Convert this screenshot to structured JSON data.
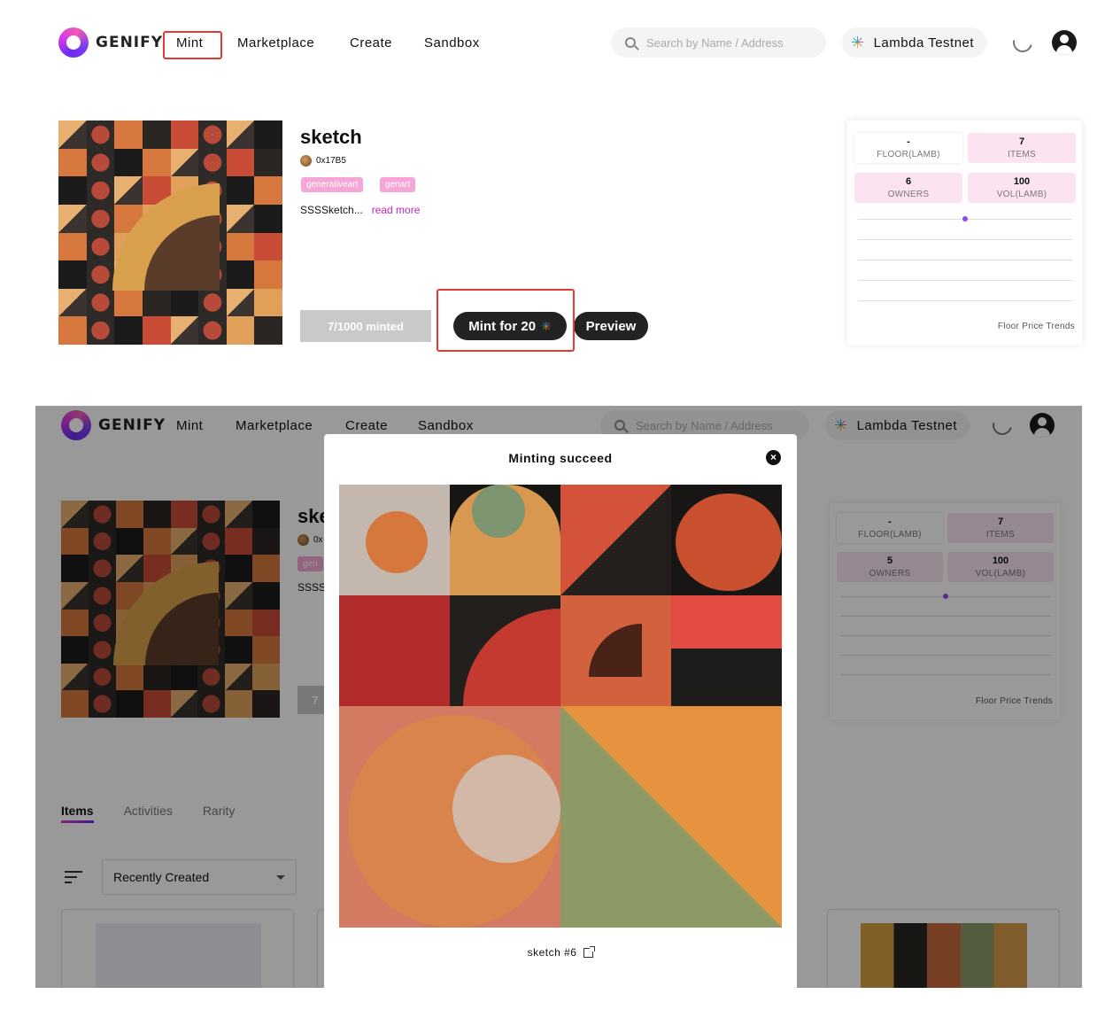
{
  "brand": {
    "name": "GENIFY"
  },
  "nav": {
    "mint": "Mint",
    "marketplace": "Marketplace",
    "create": "Create",
    "sandbox": "Sandbox"
  },
  "search": {
    "placeholder": "Search by Name / Address"
  },
  "network": {
    "label": "Lambda Testnet"
  },
  "collection": {
    "title": "sketch",
    "owner": "0x17B5",
    "tags": [
      "generativeart",
      "genart"
    ],
    "description": "SSSSketch...",
    "read_more": "read more",
    "minted": "7/1000 minted",
    "mint_button": "Mint for 20",
    "preview_button": "Preview"
  },
  "stats_top": {
    "floor": {
      "value": "-",
      "label": "FLOOR(LAMB)"
    },
    "items": {
      "value": "7",
      "label": "ITEMS"
    },
    "owners": {
      "value": "6",
      "label": "OWNERS"
    },
    "vol": {
      "value": "100",
      "label": "VOL(LAMB)"
    },
    "trend": "Floor Price Trends"
  },
  "stats_bottom": {
    "floor": {
      "value": "-",
      "label": "FLOOR(LAMB)"
    },
    "items": {
      "value": "7",
      "label": "ITEMS"
    },
    "owners": {
      "value": "5",
      "label": "OWNERS"
    },
    "vol": {
      "value": "100",
      "label": "VOL(LAMB)"
    },
    "trend": "Floor Price Trends"
  },
  "bg_title_fragment": "ske",
  "bg_owner_fragment": "0x",
  "bg_tag_fragment": "gen",
  "bg_desc_fragment": "SSSS",
  "bg_minted_fragment": "7",
  "tabs": {
    "items": "Items",
    "activities": "Activities",
    "rarity": "Rarity"
  },
  "sort": {
    "selected": "Recently Created"
  },
  "modal": {
    "title": "Minting succeed",
    "close": "×",
    "caption": "sketch #6"
  },
  "colors": {
    "accent": "#c225c2",
    "highlight": "#e53935",
    "tag": "#f6a6d6",
    "stat_pink": "#fbe3f2",
    "dark_button": "#232323"
  },
  "icons": [
    "logo-icon",
    "search-icon",
    "network-icon",
    "moon-icon",
    "user-icon",
    "close-icon",
    "filter-icon",
    "external-link-icon",
    "chevron-down-icon"
  ]
}
